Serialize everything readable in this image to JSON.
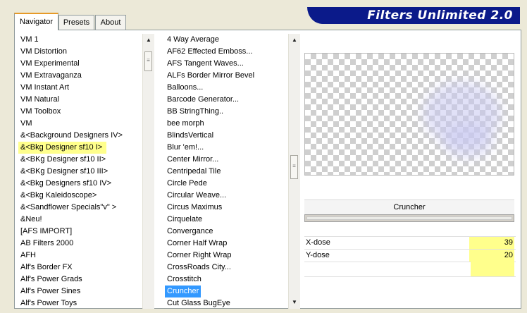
{
  "app": {
    "title": "Filters Unlimited 2.0"
  },
  "tabs": [
    {
      "label": "Navigator"
    },
    {
      "label": "Presets"
    },
    {
      "label": "About"
    }
  ],
  "categories": [
    "VM 1",
    "VM Distortion",
    "VM Experimental",
    "VM Extravaganza",
    "VM Instant Art",
    "VM Natural",
    "VM Toolbox",
    "VM",
    "&<Background Designers IV>",
    "&<Bkg Designer sf10 I>",
    "&<BKg Designer sf10 II>",
    "&<BKg Designer sf10 III>",
    "&<Bkg Designers sf10 IV>",
    "&<Bkg Kaleidoscope>",
    "&<Sandflower Specials\"v\" >",
    "&Neu!",
    "[AFS IMPORT]",
    "AB Filters 2000",
    "AFH",
    "Alf's Border FX",
    "Alf's Power Grads",
    "Alf's Power Sines",
    "Alf's Power Toys"
  ],
  "categories_highlighted_index": 9,
  "filters": [
    "4 Way Average",
    "AF62 Effected Emboss...",
    "AFS Tangent Waves...",
    "ALFs Border Mirror Bevel",
    "Balloons...",
    "Barcode Generator...",
    "BB StringThing..",
    "bee morph",
    "BlindsVertical",
    "Blur 'em!...",
    "Center Mirror...",
    "Centripedal Tile",
    "Circle Pede",
    "Circular Weave...",
    "Circus Maximus",
    "Cirquelate",
    "Convergance",
    "Corner Half Wrap",
    "Corner Right Wrap",
    "CrossRoads City...",
    "Crosstitch",
    "Cruncher",
    "Cut Glass  BugEye"
  ],
  "filters_selected_index": 21,
  "selected_filter": {
    "name": "Cruncher"
  },
  "params": [
    {
      "label": "X-dose",
      "value": "39"
    },
    {
      "label": "Y-dose",
      "value": "20"
    }
  ],
  "colors": {
    "accent_highlight": "#ffff8c",
    "selection": "#3399ff",
    "banner": "#0b1a8a"
  },
  "icons": {
    "scroll_up": "up-arrow-icon",
    "scroll_down": "down-arrow-icon",
    "grip": "scroll-grip-icon"
  }
}
